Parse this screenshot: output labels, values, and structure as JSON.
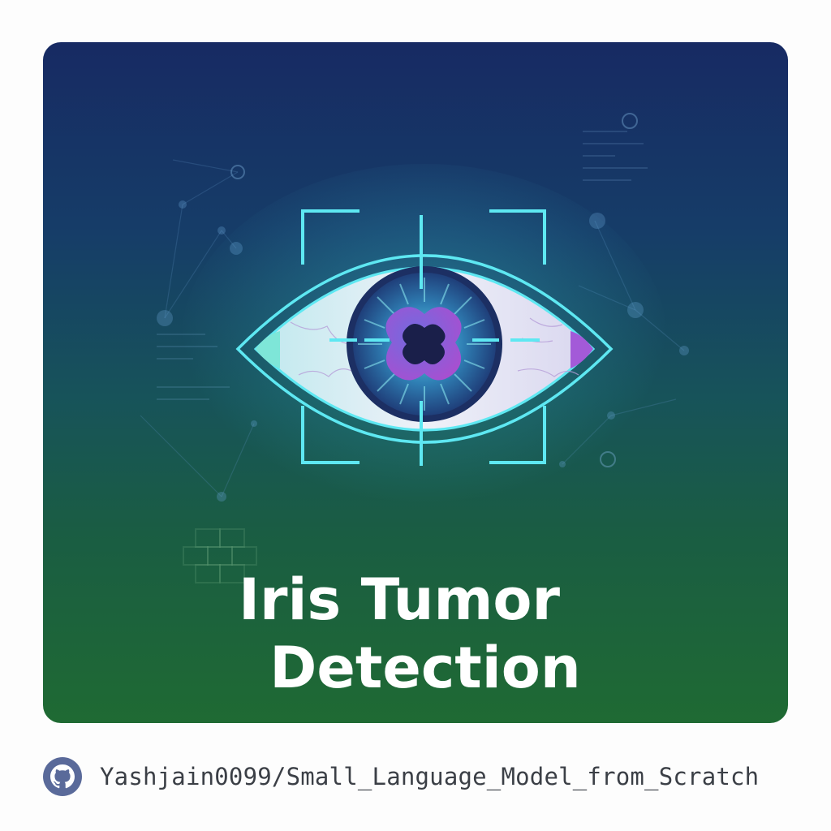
{
  "card": {
    "title_line1": "Iris Tumor",
    "title_line2": "Detection",
    "illustration": "eye-scan-icon",
    "colors": {
      "gradient_top": "#172a63",
      "gradient_bottom": "#1f6a33",
      "scan_lines": "#5ee8f2",
      "iris": "#2f5fa0",
      "tumor": "#9a4fd6"
    }
  },
  "footer": {
    "icon": "github-icon",
    "repo": "Yashjain0099/Small_Language_Model_from_Scratch"
  }
}
